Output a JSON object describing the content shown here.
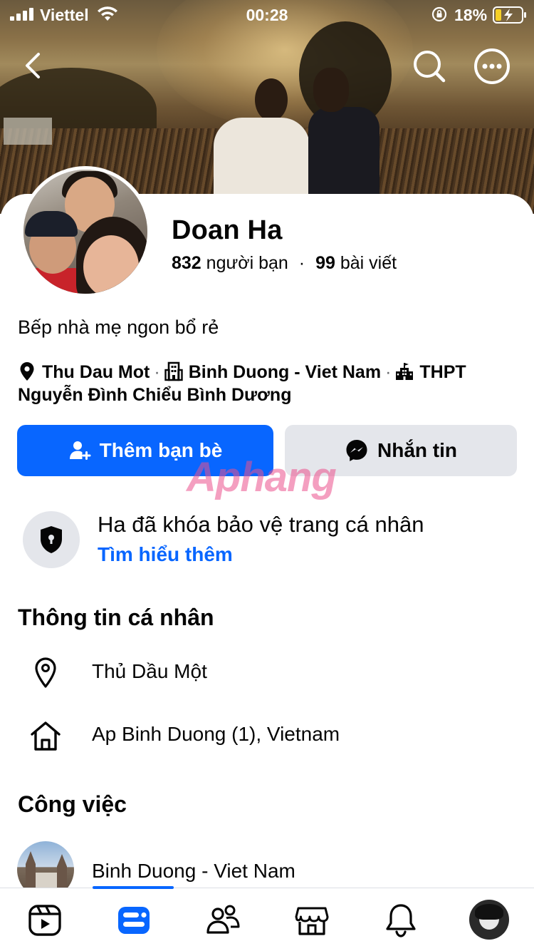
{
  "status_bar": {
    "carrier": "Viettel",
    "time": "00:28",
    "battery_percent": "18%"
  },
  "header": {
    "back_icon": "chevron-left-icon",
    "search_icon": "search-icon",
    "more_icon": "more-horizontal-icon"
  },
  "profile": {
    "name": "Doan Ha",
    "friends_count": "832",
    "friends_label": "người bạn",
    "separator": "·",
    "posts_count": "99",
    "posts_label": "bài viết",
    "bio": "Bếp nhà mẹ ngon bổ rẻ",
    "details": {
      "city": "Thu Dau Mot",
      "work": "Binh Duong - Viet Nam",
      "school": "THPT Nguyễn Đình Chiểu Bình Dương",
      "separator": "·"
    }
  },
  "actions": {
    "add_friend_label": "Thêm bạn bè",
    "message_label": "Nhắn tin"
  },
  "watermark": "Aphang",
  "lock_notice": {
    "title": "Ha đã khóa bảo vệ trang cá nhân",
    "link": "Tìm hiểu thêm"
  },
  "personal_info": {
    "title": "Thông tin cá nhân",
    "city": "Thủ Dầu Một",
    "home": "Ap Binh Duong (1), Vietnam"
  },
  "work_section": {
    "title": "Công việc",
    "item": "Binh Duong - Viet Nam"
  },
  "tab_bar": {
    "active_tab": "profile",
    "accent": "#0866ff",
    "tabs": [
      "video-icon",
      "profile-card-icon",
      "friends-icon",
      "marketplace-icon",
      "bell-icon",
      "avatar"
    ]
  },
  "colors": {
    "primary_button": "#0866ff",
    "secondary_button": "#e4e6eb",
    "link": "#0866ff"
  }
}
